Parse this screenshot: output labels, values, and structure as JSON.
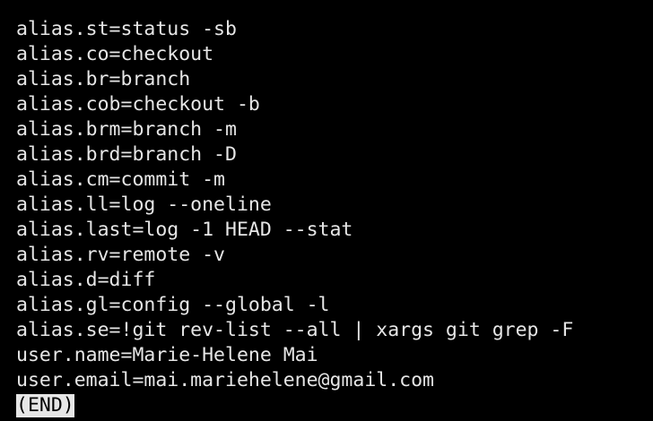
{
  "terminal": {
    "lines": [
      "alias.st=status -sb",
      "alias.co=checkout",
      "alias.br=branch",
      "alias.cob=checkout -b",
      "alias.brm=branch -m",
      "alias.brd=branch -D",
      "alias.cm=commit -m",
      "alias.ll=log --oneline",
      "alias.last=log -1 HEAD --stat",
      "alias.rv=remote -v",
      "alias.d=diff",
      "alias.gl=config --global -l",
      "alias.se=!git rev-list --all | xargs git grep -F",
      "user.name=Marie-Helene Mai",
      "user.email=mai.mariehelene@gmail.com"
    ],
    "pager_prompt": "(END)"
  },
  "colors": {
    "background": "#000000",
    "foreground": "#e6e6e6"
  }
}
